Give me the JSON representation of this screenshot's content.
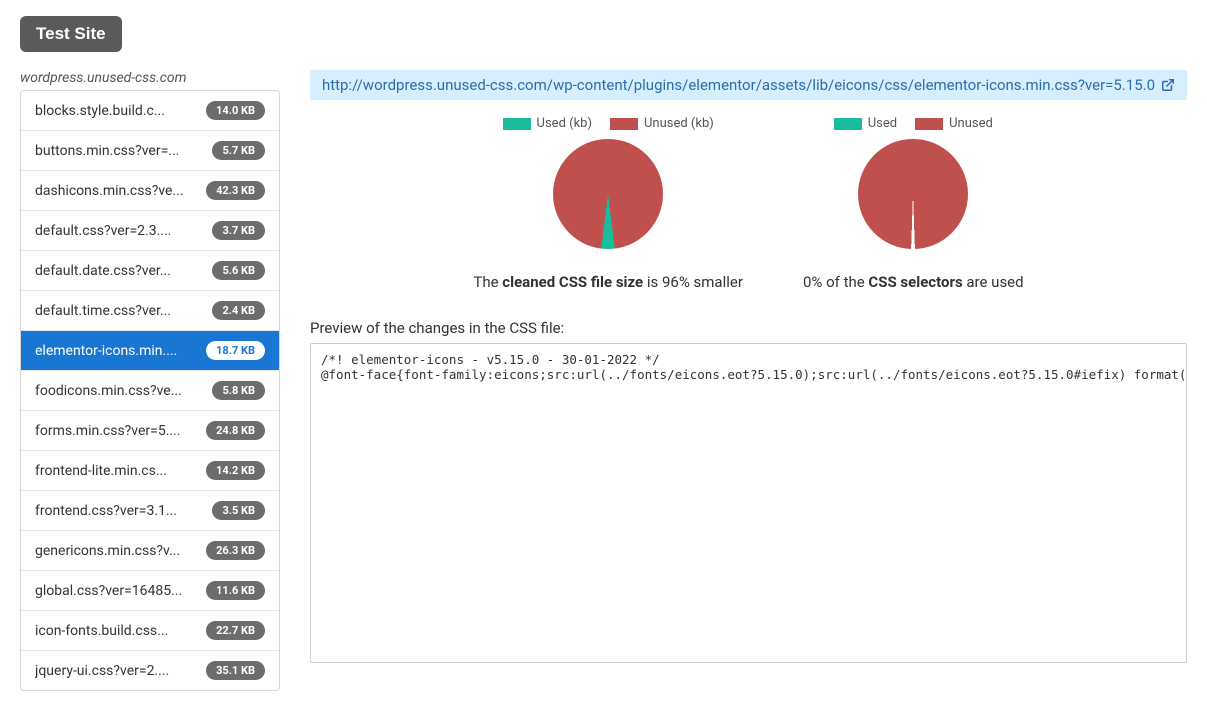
{
  "test_button_label": "Test Site",
  "site_label": "wordpress.unused-css.com",
  "files": [
    {
      "name": "blocks.style.build.c...",
      "size": "14.0 KB",
      "active": false
    },
    {
      "name": "buttons.min.css?ver=...",
      "size": "5.7 KB",
      "active": false
    },
    {
      "name": "dashicons.min.css?ve...",
      "size": "42.3 KB",
      "active": false
    },
    {
      "name": "default.css?ver=2.3....",
      "size": "3.7 KB",
      "active": false
    },
    {
      "name": "default.date.css?ver...",
      "size": "5.6 KB",
      "active": false
    },
    {
      "name": "default.time.css?ver...",
      "size": "2.4 KB",
      "active": false
    },
    {
      "name": "elementor-icons.min....",
      "size": "18.7 KB",
      "active": true
    },
    {
      "name": "foodicons.min.css?ve...",
      "size": "5.8 KB",
      "active": false
    },
    {
      "name": "forms.min.css?ver=5....",
      "size": "24.8 KB",
      "active": false
    },
    {
      "name": "frontend-lite.min.cs...",
      "size": "14.2 KB",
      "active": false
    },
    {
      "name": "frontend.css?ver=3.1...",
      "size": "3.5 KB",
      "active": false
    },
    {
      "name": "genericons.min.css?v...",
      "size": "26.3 KB",
      "active": false
    },
    {
      "name": "global.css?ver=16485...",
      "size": "11.6 KB",
      "active": false
    },
    {
      "name": "icon-fonts.build.css...",
      "size": "22.7 KB",
      "active": false
    },
    {
      "name": "jquery-ui.css?ver=2....",
      "size": "35.1 KB",
      "active": false
    }
  ],
  "url_bar": "http://wordpress.unused-css.com/wp-content/plugins/elementor/assets/lib/eicons/css/elementor-icons.min.css?ver=5.15.0",
  "chart_data": [
    {
      "type": "pie",
      "legend": [
        "Used (kb)",
        "Unused (kb)"
      ],
      "labels": [
        "Used",
        "Unused"
      ],
      "values": [
        4,
        96
      ],
      "colors": [
        "#1abc9c",
        "#c0504d"
      ],
      "caption_prefix": "The ",
      "caption_bold": "cleaned CSS file size",
      "caption_suffix": " is 96% smaller"
    },
    {
      "type": "pie",
      "legend": [
        "Used",
        "Unused"
      ],
      "labels": [
        "Used",
        "Unused"
      ],
      "values": [
        0,
        100
      ],
      "colors": [
        "#1abc9c",
        "#c0504d"
      ],
      "caption_prefix": "0% of the ",
      "caption_bold": "CSS selectors",
      "caption_suffix": " are used"
    }
  ],
  "preview_label": "Preview of the changes in the CSS file:",
  "code_lines": [
    "/*! elementor-icons - v5.15.0 - 30-01-2022 */",
    "@font-face{font-family:eicons;src:url(../fonts/eicons.eot?5.15.0);src:url(../fonts/eicons.eot?5.15.0#iefix) format(\"e"
  ]
}
